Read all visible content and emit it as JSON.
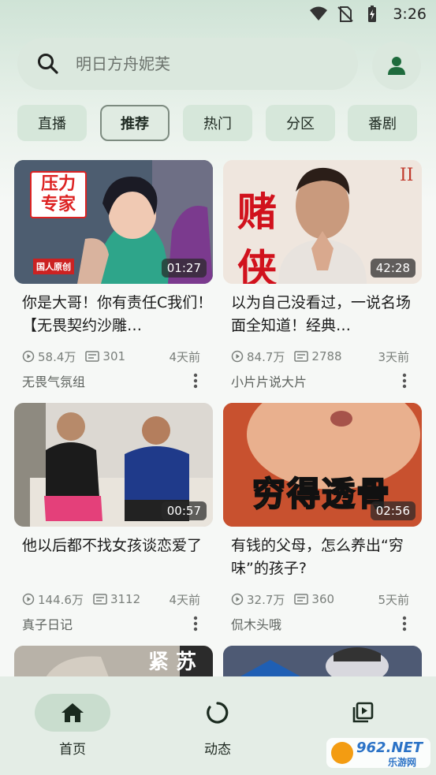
{
  "status_bar": {
    "time": "3:26"
  },
  "search": {
    "placeholder": "明日方舟妮芙"
  },
  "categories": [
    {
      "label": "直播",
      "active": false
    },
    {
      "label": "推荐",
      "active": true
    },
    {
      "label": "热门",
      "active": false
    },
    {
      "label": "分区",
      "active": false
    },
    {
      "label": "番剧",
      "active": false
    }
  ],
  "videos": [
    {
      "title": "你是大哥！你有责任C我们！【无畏契约沙雕…",
      "duration": "01:27",
      "views": "58.4万",
      "comments": "301",
      "date": "4天前",
      "author": "无畏气氛组",
      "thumb_text": "压力专家",
      "thumb_subtext": "国人原创"
    },
    {
      "title": "以为自己没看过，一说名场面全知道！经典…",
      "duration": "42:28",
      "views": "84.7万",
      "comments": "2788",
      "date": "3天前",
      "author": "小片片说大片",
      "thumb_text": "赌侠",
      "thumb_subtext": ""
    },
    {
      "title": "他以后都不找女孩谈恋爱了",
      "duration": "00:57",
      "views": "144.6万",
      "comments": "3112",
      "date": "4天前",
      "author": "真子日记",
      "thumb_text": "",
      "thumb_subtext": ""
    },
    {
      "title": "有钱的父母，怎么养出“穷味”的孩子?",
      "duration": "02:56",
      "views": "32.7万",
      "comments": "360",
      "date": "5天前",
      "author": "侃木头哦",
      "thumb_text": "穷得透骨",
      "thumb_subtext": ""
    }
  ],
  "partial_thumbs": [
    {
      "thumb_text": "紧 苏"
    },
    {
      "thumb_text": ""
    }
  ],
  "nav": [
    {
      "label": "首页",
      "icon": "home-icon",
      "active": true
    },
    {
      "label": "动态",
      "icon": "refresh-circle-icon",
      "active": false
    },
    {
      "label": "",
      "icon": "playlist-icon",
      "active": false
    }
  ],
  "watermark": {
    "text": "962.NET",
    "subtext": "乐游网"
  },
  "colors": {
    "accent": "#1f6b3d",
    "chip_bg": "#d6e7da",
    "nav_bg": "#e4ede6"
  }
}
